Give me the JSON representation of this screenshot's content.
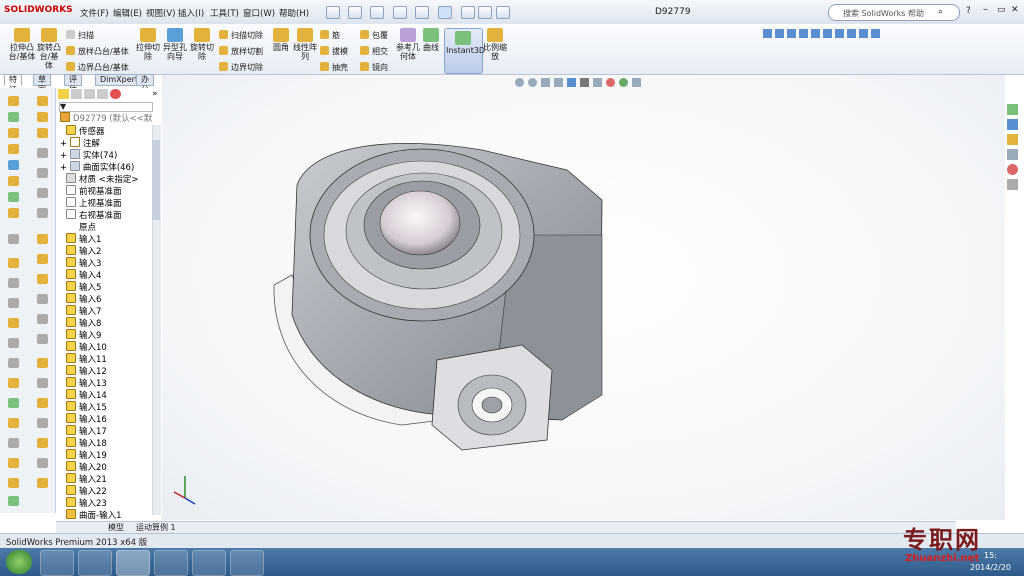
{
  "app": {
    "brand": "SOLIDWORKS",
    "document_title": "D92779"
  },
  "menu": [
    "文件(F)",
    "编辑(E)",
    "视图(V)",
    "插入(I)",
    "工具(T)",
    "窗口(W)",
    "帮助(H)"
  ],
  "search": {
    "placeholder": "搜索 SolidWorks 帮助"
  },
  "command_manager": {
    "extrude_boss": "拉伸凸台/基体",
    "revolve_boss": "旋转凸台/基体",
    "sweep": "扫描",
    "loft_boss": "放样凸台/基体",
    "boundary_boss": "边界凸台/基体",
    "extrude_cut": "拉伸切除",
    "hole_wizard": "异型孔向导",
    "revolve_cut": "旋转切除",
    "swept_cut": "扫描切除",
    "lofted_cut": "放样切割",
    "boundary_cut": "边界切除",
    "fillet": "圆角",
    "linear_pattern": "线性阵列",
    "rib": "筋",
    "draft": "拔模",
    "shell": "抽壳",
    "wrap": "包覆",
    "intersect": "相交",
    "mirror": "镜向",
    "ref_geometry": "参考几何体",
    "curves": "曲线",
    "instant3d": "Instant3D",
    "scale": "比例缩放"
  },
  "tabs": [
    "特征",
    "草图",
    "评估",
    "DimXpert",
    "办公室产品"
  ],
  "tree": {
    "root": "D92779 (默认<<默",
    "items": [
      "传感器",
      "注解",
      "实体(74)",
      "曲面实体(46)",
      "材质 <未指定>",
      "前视基准面",
      "上视基准面",
      "右视基准面",
      "原点",
      "输入1",
      "输入2",
      "输入3",
      "输入4",
      "输入5",
      "输入6",
      "输入7",
      "输入8",
      "输入9",
      "输入10",
      "输入11",
      "输入12",
      "输入13",
      "输入14",
      "输入15",
      "输入16",
      "输入17",
      "输入18",
      "输入19",
      "输入20",
      "输入21",
      "输入22",
      "输入23"
    ],
    "last": "曲面-输入1"
  },
  "bottom_tabs": [
    "模型",
    "运动算例 1"
  ],
  "status": {
    "text": "SolidWorks Premium 2013 x64 版"
  },
  "clock": {
    "time": "15:",
    "date": "2014/2/20"
  },
  "watermark": {
    "cn": "专职网",
    "en": "Zhuanzhi.net"
  },
  "colors": {
    "accent": "#c00000",
    "taskbar": "#3a6797",
    "part": "#9a9da3"
  }
}
